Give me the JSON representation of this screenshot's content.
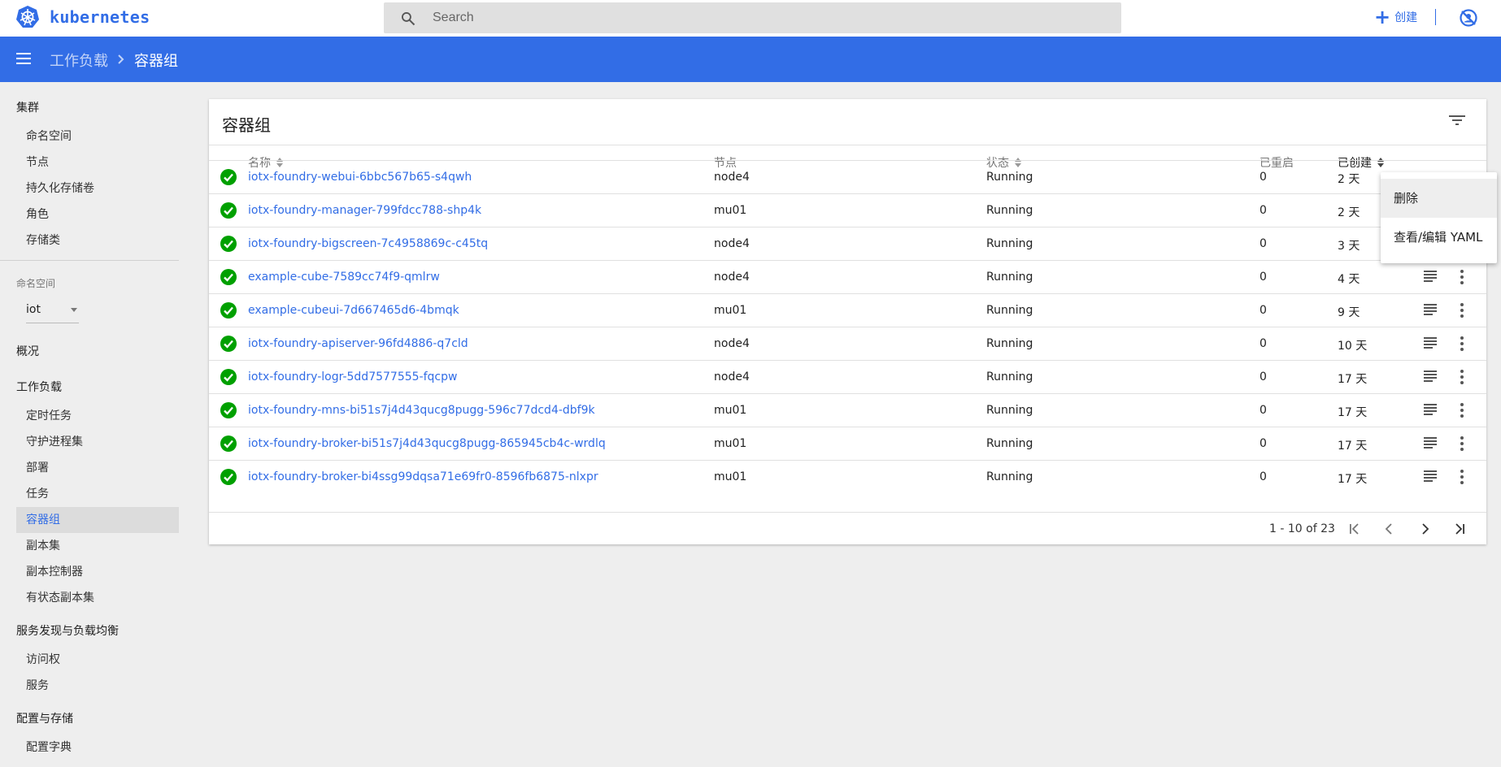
{
  "app": {
    "brand": "kubernetes"
  },
  "search": {
    "placeholder": "Search"
  },
  "header": {
    "create_label": "创建"
  },
  "breadcrumb": {
    "parent": "工作负载",
    "current": "容器组"
  },
  "sidebar": {
    "cluster_heading": "集群",
    "cluster_items": [
      "命名空间",
      "节点",
      "持久化存储卷",
      "角色",
      "存储类"
    ],
    "namespace_label": "命名空间",
    "namespace_value": "iot",
    "overview": "概况",
    "workloads_heading": "工作负载",
    "workload_items": [
      "定时任务",
      "守护进程集",
      "部署",
      "任务",
      "容器组",
      "副本集",
      "副本控制器",
      "有状态副本集"
    ],
    "active_item": "容器组",
    "discovery_heading": "服务发现与负载均衡",
    "discovery_items": [
      "访问权",
      "服务"
    ],
    "config_heading": "配置与存储",
    "config_items": [
      "配置字典"
    ]
  },
  "card": {
    "title": "容器组",
    "columns": {
      "name": "名称",
      "node": "节点",
      "status": "状态",
      "restarts": "已重启",
      "created": "已创建"
    },
    "rows": [
      {
        "name": "iotx-foundry-webui-6bbc567b65-s4qwh",
        "node": "node4",
        "status": "Running",
        "restarts": "0",
        "created": "2 天"
      },
      {
        "name": "iotx-foundry-manager-799fdcc788-shp4k",
        "node": "mu01",
        "status": "Running",
        "restarts": "0",
        "created": "2 天"
      },
      {
        "name": "iotx-foundry-bigscreen-7c4958869c-c45tq",
        "node": "node4",
        "status": "Running",
        "restarts": "0",
        "created": "3 天"
      },
      {
        "name": "example-cube-7589cc74f9-qmlrw",
        "node": "node4",
        "status": "Running",
        "restarts": "0",
        "created": "4 天"
      },
      {
        "name": "example-cubeui-7d667465d6-4bmqk",
        "node": "mu01",
        "status": "Running",
        "restarts": "0",
        "created": "9 天"
      },
      {
        "name": "iotx-foundry-apiserver-96fd4886-q7cld",
        "node": "node4",
        "status": "Running",
        "restarts": "0",
        "created": "10 天"
      },
      {
        "name": "iotx-foundry-logr-5dd7577555-fqcpw",
        "node": "node4",
        "status": "Running",
        "restarts": "0",
        "created": "17 天"
      },
      {
        "name": "iotx-foundry-mns-bi51s7j4d43qucg8pugg-596c77dcd4-dbf9k",
        "node": "mu01",
        "status": "Running",
        "restarts": "0",
        "created": "17 天"
      },
      {
        "name": "iotx-foundry-broker-bi51s7j4d43qucg8pugg-865945cb4c-wrdlq",
        "node": "mu01",
        "status": "Running",
        "restarts": "0",
        "created": "17 天"
      },
      {
        "name": "iotx-foundry-broker-bi4ssg99dqsa71e69fr0-8596fb6875-nlxpr",
        "node": "mu01",
        "status": "Running",
        "restarts": "0",
        "created": "17 天"
      }
    ],
    "pagination": "1 - 10 of 23"
  },
  "context_menu": {
    "items": [
      "删除",
      "查看/编辑 YAML"
    ]
  },
  "colors": {
    "primary": "#326de6",
    "success": "#00a000"
  },
  "icons": [
    "kubernetes-logo",
    "search-icon",
    "plus-icon",
    "user-off-icon",
    "menu-icon",
    "chevron-right-icon",
    "filter-icon",
    "check-circle-icon",
    "logs-icon",
    "more-vert-icon",
    "first-page-icon",
    "prev-page-icon",
    "next-page-icon",
    "last-page-icon"
  ]
}
